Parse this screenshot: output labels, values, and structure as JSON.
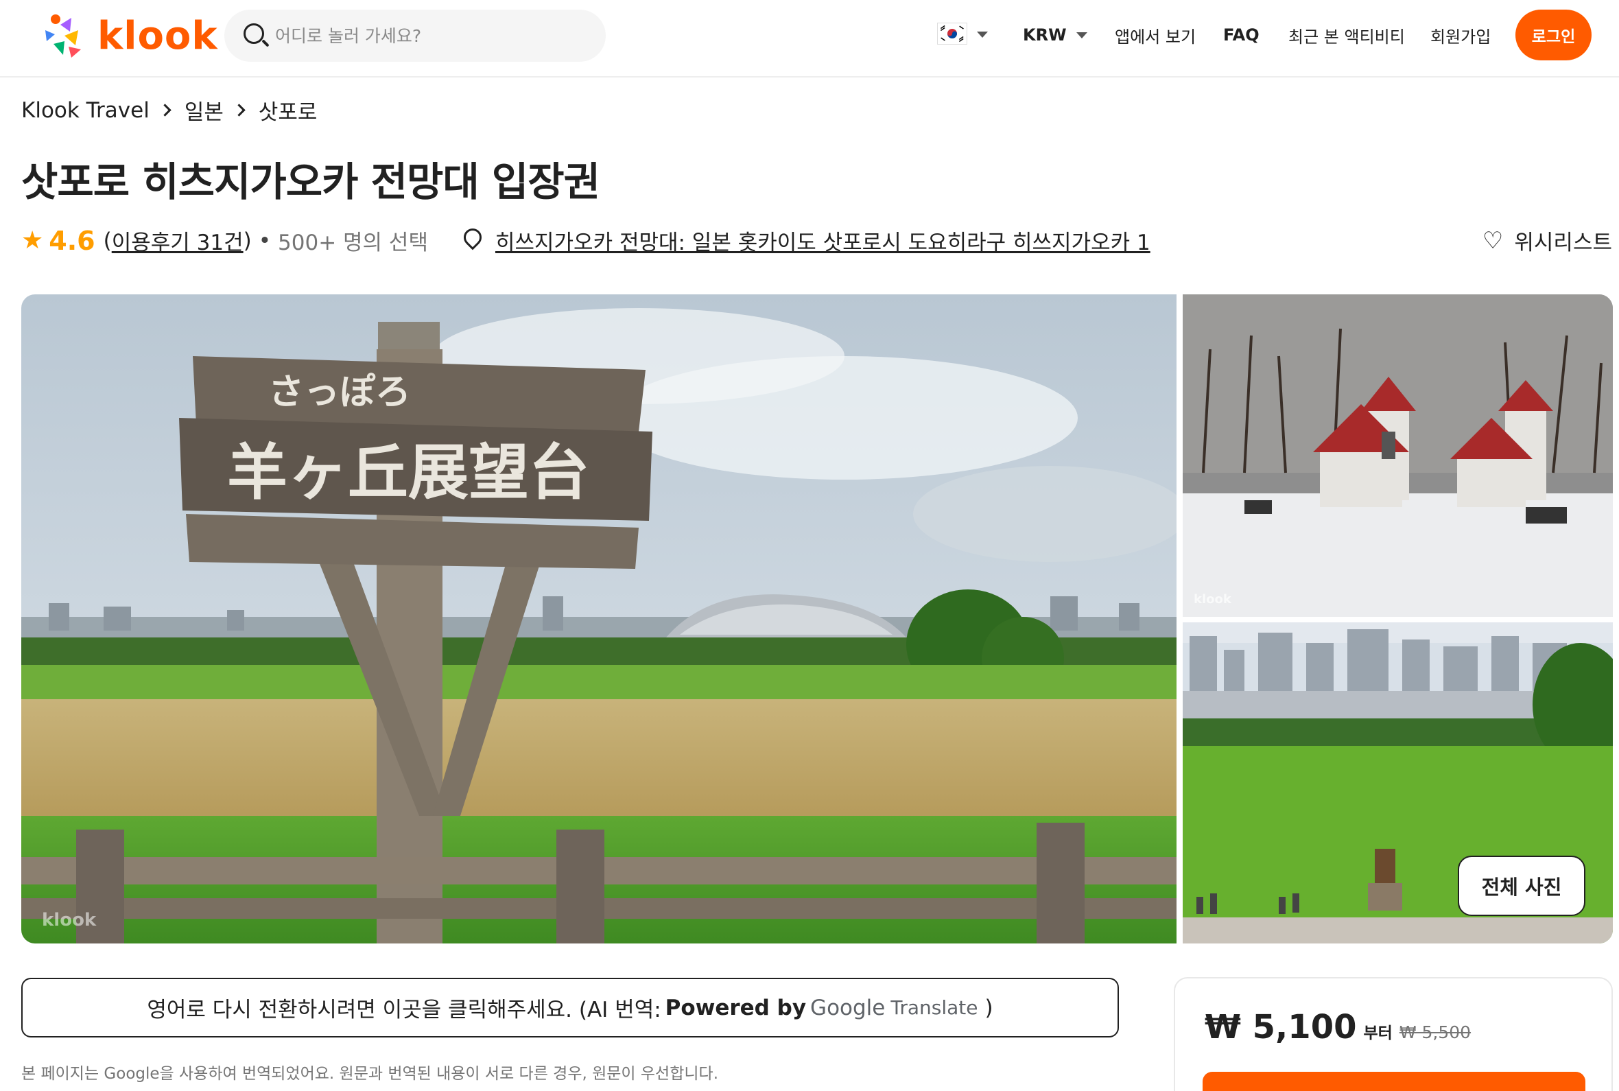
{
  "header": {
    "logo_text": "klook",
    "search_placeholder": "어디로 놀러 가세요?",
    "currency": "KRW",
    "nav_items": [
      "앱에서 보기",
      "FAQ",
      "최근 본 액티비티",
      "회원가입"
    ],
    "login_label": "로그인",
    "brand_color": "#ff5b00"
  },
  "breadcrumb": [
    "Klook Travel",
    "일본",
    "삿포로"
  ],
  "title": "삿포로 히츠지가오카 전망대 입장권",
  "meta": {
    "rating": "4.6",
    "reviews": "이용후기 31건",
    "booked": "500+ 명의 선택",
    "address": "히쓰지가오카 전망대: 일본 홋카이도 삿포로시 도요히라구 히쓰지가오카 1",
    "wishlist": "위시리스트"
  },
  "gallery": {
    "sign_text_top": "さっぽろ",
    "sign_text_main": "羊ヶ丘展望台",
    "watermark": "klook",
    "all_photos_label": "전체 사진"
  },
  "translation": {
    "banner_text": "영어로 다시 전환하시려면 이곳을 클릭해주세요. (AI 번역: ",
    "powered_by": "Powered by",
    "google": "Google",
    "translate": "Translate",
    "close_paren": ")",
    "note": "본 페이지는 Google을 사용하여 번역되었어요. 원문과 번역된 내용이 서로 다른 경우, 원문이 우선합니다."
  },
  "price": {
    "current": "₩ 5,100",
    "from": "부터",
    "original": "₩ 5,500"
  }
}
